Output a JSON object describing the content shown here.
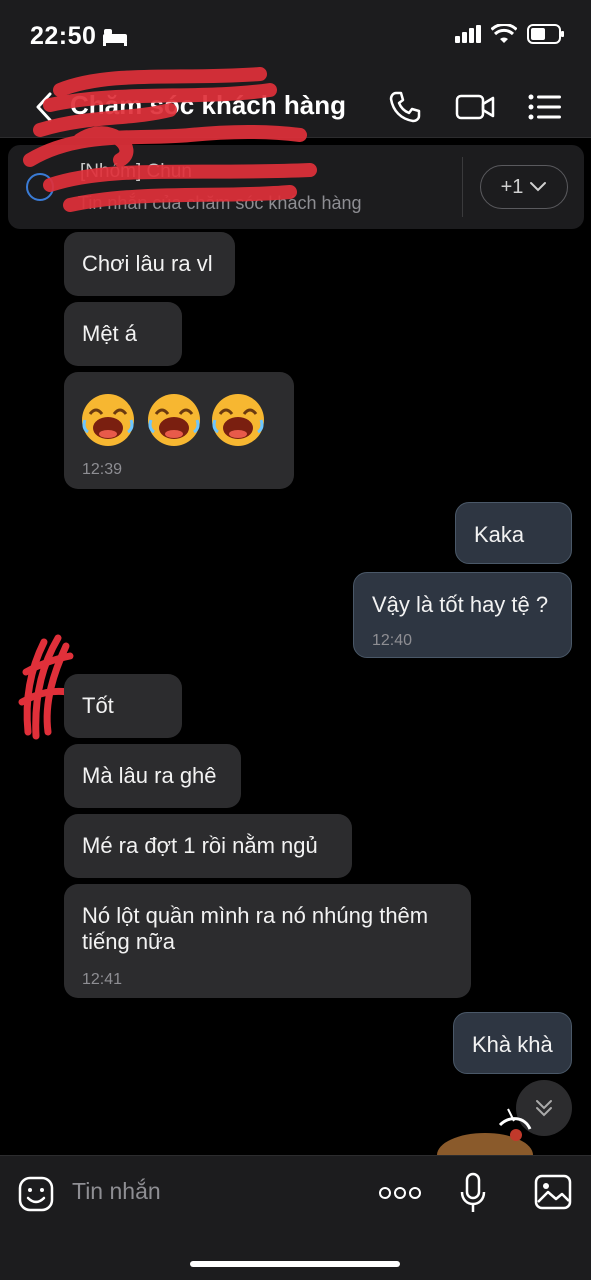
{
  "status": {
    "time": "22:50"
  },
  "header": {
    "title": "Chăm sóc khách hàng"
  },
  "pinned": {
    "name": "[Nhóm] Chun",
    "subtitle": "Tin nhắn của chăm sóc khách hàng",
    "more_label": "+1"
  },
  "messages": [
    {
      "dir": "in",
      "text": "Chơi lâu ra vl"
    },
    {
      "dir": "in",
      "text": "Mệt á"
    },
    {
      "dir": "in",
      "emojis": [
        "laughing-face",
        "laughing-face",
        "laughing-face"
      ],
      "time": "12:39"
    },
    {
      "dir": "out",
      "text": "Kaka"
    },
    {
      "dir": "out",
      "text": "Vậy là tốt hay tệ ?",
      "time": "12:40"
    },
    {
      "dir": "in",
      "text": "Tốt"
    },
    {
      "dir": "in",
      "text": "Mà lâu ra ghê"
    },
    {
      "dir": "in",
      "text": "Mé ra đợt 1 rồi nằm ngủ"
    },
    {
      "dir": "in",
      "text_line1": "Nó lột quần mình ra nó nhúng thêm",
      "text_line2": "tiếng nữa",
      "time": "12:41"
    },
    {
      "dir": "out",
      "text": "Khà khà"
    }
  ],
  "composer": {
    "placeholder": "Tin nhắn"
  },
  "colors": {
    "bg": "#000000",
    "bar": "#1c1c1e",
    "in_bubble": "#2c2c2e",
    "out_bubble": "#2e3642",
    "scribble": "#e0303a"
  }
}
